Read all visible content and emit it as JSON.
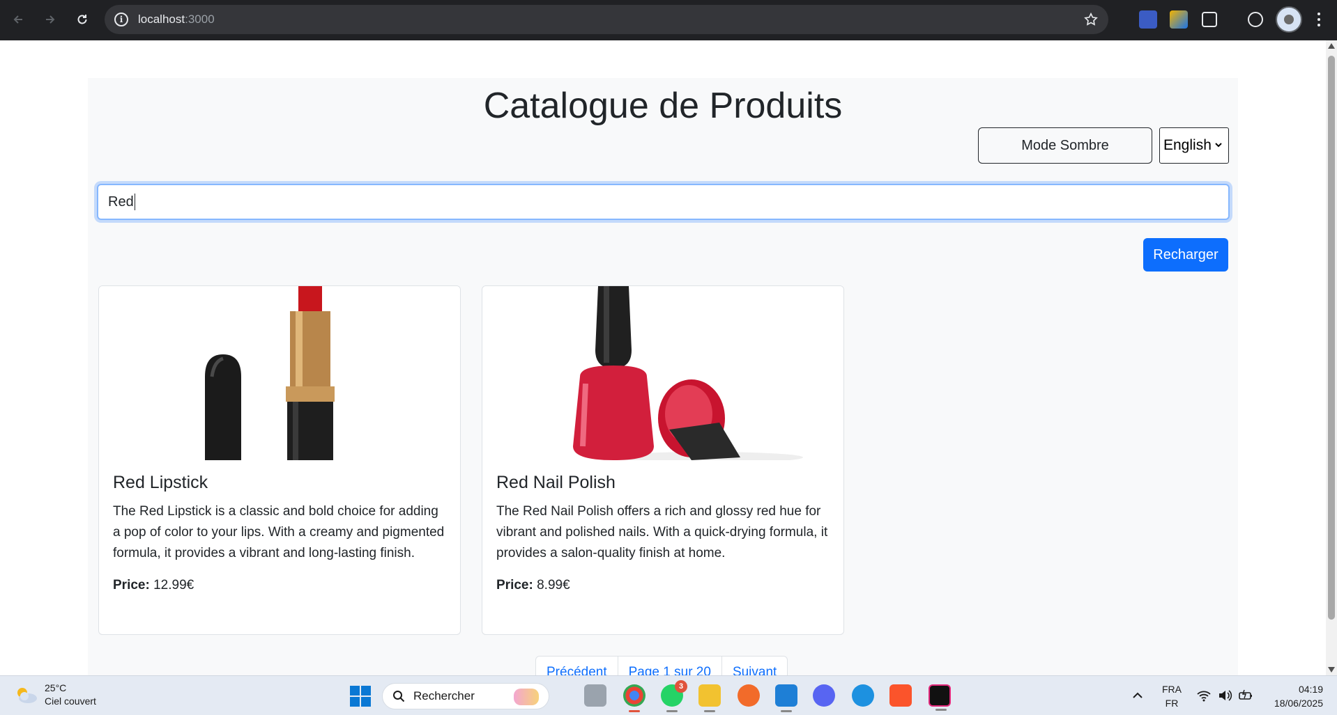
{
  "browser": {
    "url_host": "localhost",
    "url_port": ":3000"
  },
  "page": {
    "title": "Catalogue de Produits",
    "mode_button": "Mode Sombre",
    "language_selected": "English",
    "search_value": "Red",
    "reload_button": "Recharger"
  },
  "products": [
    {
      "name": "Red Lipstick",
      "description": "The Red Lipstick is a classic and bold choice for adding a pop of color to your lips. With a creamy and pigmented formula, it provides a vibrant and long-lasting finish.",
      "price_label": "Price:",
      "price_value": "12.99€"
    },
    {
      "name": "Red Nail Polish",
      "description": "The Red Nail Polish offers a rich and glossy red hue for vibrant and polished nails. With a quick-drying formula, it provides a salon-quality finish at home.",
      "price_label": "Price:",
      "price_value": "8.99€"
    }
  ],
  "pagination": {
    "previous": "Précédent",
    "page_info": "Page 1 sur 20",
    "next": "Suivant"
  },
  "taskbar": {
    "temperature": "25°C",
    "weather_desc": "Ciel couvert",
    "search_placeholder": "Rechercher",
    "whatsapp_badge": "3",
    "lang_top": "FRA",
    "lang_bottom": "FR",
    "time": "04:19",
    "date": "18/06/2025"
  },
  "colors": {
    "primary": "#0d6efd",
    "page_bg": "#f8f9fa",
    "chrome_bg": "#202124",
    "taskbar_bg": "#e4eaf3"
  }
}
